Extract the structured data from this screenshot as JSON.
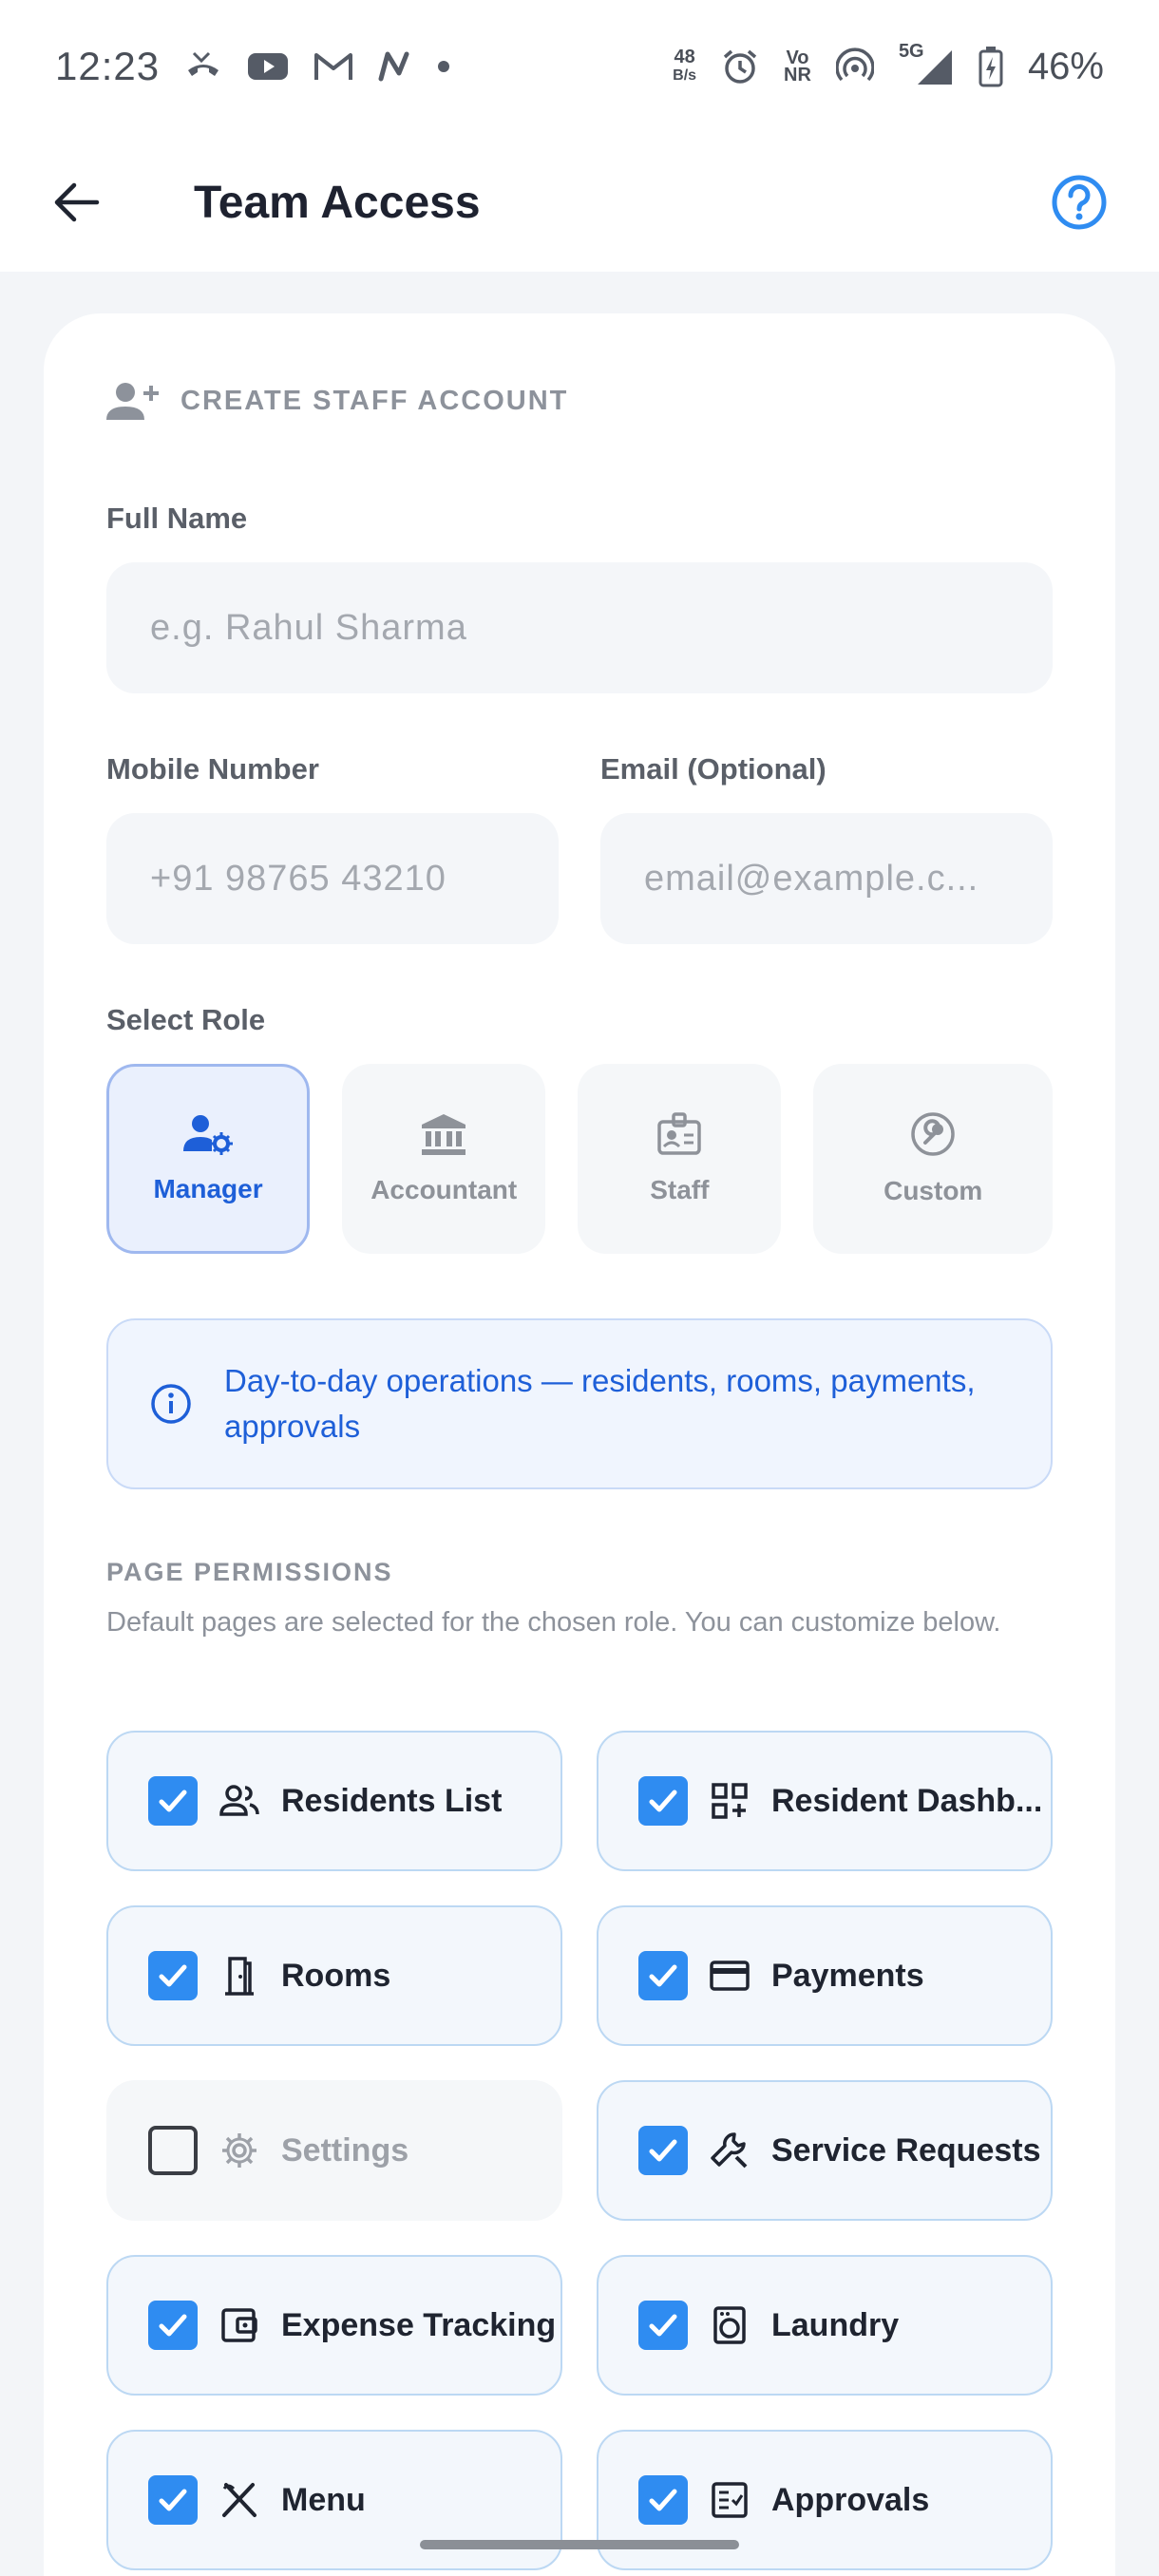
{
  "status_bar": {
    "time": "12:23",
    "net_speed_value": "48",
    "net_speed_unit": "B/s",
    "volte_top": "Vo",
    "volte_bottom": "NR",
    "signal_label": "5G",
    "battery": "46%"
  },
  "app_bar": {
    "title": "Team Access"
  },
  "form": {
    "section_title": "CREATE STAFF ACCOUNT",
    "full_name": {
      "label": "Full Name",
      "placeholder": "e.g. Rahul Sharma"
    },
    "mobile": {
      "label": "Mobile Number",
      "placeholder": "+91 98765 43210"
    },
    "email": {
      "label": "Email (Optional)",
      "placeholder": "email@example.c..."
    },
    "role_label": "Select Role",
    "roles": [
      {
        "label": "Manager",
        "icon": "manager-settings-icon",
        "selected": true
      },
      {
        "label": "Accountant",
        "icon": "bank-icon",
        "selected": false
      },
      {
        "label": "Staff",
        "icon": "badge-icon",
        "selected": false
      },
      {
        "label": "Custom",
        "icon": "wrench-circle-icon",
        "selected": false
      }
    ],
    "role_info": "Day-to-day operations — residents, rooms, payments, approvals",
    "permissions_title": "PAGE PERMISSIONS",
    "permissions_desc": "Default pages are selected for the chosen role. You can customize below.",
    "permissions": [
      {
        "label": "Residents List",
        "icon": "people-icon",
        "checked": true
      },
      {
        "label": "Resident Dashb...",
        "icon": "dashboard-add-icon",
        "checked": true
      },
      {
        "label": "Rooms",
        "icon": "door-icon",
        "checked": true
      },
      {
        "label": "Payments",
        "icon": "card-icon",
        "checked": true
      },
      {
        "label": "Settings",
        "icon": "gear-icon",
        "checked": false
      },
      {
        "label": "Service Requests",
        "icon": "wrench-icon",
        "checked": true
      },
      {
        "label": "Expense Tracking",
        "icon": "wallet-icon",
        "checked": true
      },
      {
        "label": "Laundry",
        "icon": "washing-machine-icon",
        "checked": true
      },
      {
        "label": "Menu",
        "icon": "fork-knife-icon",
        "checked": true
      },
      {
        "label": "Approvals",
        "icon": "checklist-icon",
        "checked": true
      }
    ]
  },
  "colors": {
    "accent": "#2f8cf1",
    "primary_text": "#1e5fd8",
    "muted": "#8d929b"
  }
}
